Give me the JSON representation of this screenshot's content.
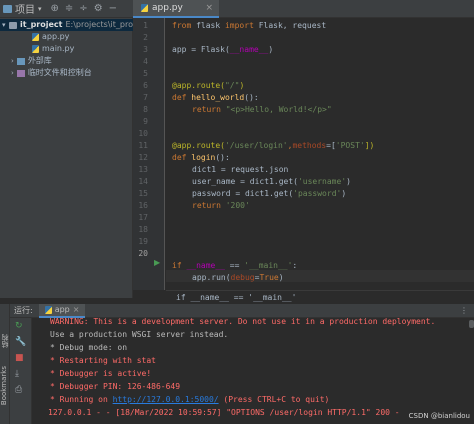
{
  "project": {
    "header_label": "项目",
    "root_name": "it_project",
    "root_path": "E:\\projects\\it_pro",
    "files": [
      "app.py",
      "main.py"
    ],
    "external": "外部库",
    "scratches": "临时文件和控制台"
  },
  "editor": {
    "tab_label": "app.py",
    "line_numbers": [
      "1",
      "2",
      "3",
      "4",
      "5",
      "6",
      "7",
      "8",
      "9",
      "10",
      "11",
      "12",
      "13",
      "14",
      "15",
      "16",
      "17",
      "18",
      "19",
      "20"
    ],
    "breadcrumb": "if __name__ == '__main__'"
  },
  "code": {
    "l1_from": "from",
    "l1_mod": " flask ",
    "l1_import": "import",
    "l1_rest": " Flask, request",
    "l3_a": "app = Flask(",
    "l3_dunder": "__name__",
    "l3_b": ")",
    "l6_dec": "@app.route(",
    "l6_str": "\"/\"",
    "l6_end": ")",
    "l7_def": "def ",
    "l7_fn": "hello_world",
    "l7_rest": "():",
    "l8_ret": "return ",
    "l8_str": "\"<p>Hello, World!</p>\"",
    "l11_dec": "@app.route(",
    "l11_str": "'/user/login'",
    "l11_comma": ",",
    "l11_param": "methods",
    "l11_eq": "=[",
    "l11_post": "'POST'",
    "l11_end": "])",
    "l12_def": "def ",
    "l12_fn": "login",
    "l12_rest": "():",
    "l13": "dict1 = request.json",
    "l14_a": "user_name = dict1.get(",
    "l14_str": "'username'",
    "l14_b": ")",
    "l15_a": "password = dict1.get(",
    "l15_str": "'password'",
    "l15_b": ")",
    "l16_ret": "return ",
    "l16_str": "'200'",
    "l19_if": "if ",
    "l19_dunder": "__name__",
    "l19_mid": " == ",
    "l19_str": "'__main__'",
    "l19_end": ":",
    "l20_a": "app.run(",
    "l20_param": "debug",
    "l20_eq": "=",
    "l20_true": "True",
    "l20_b": ")"
  },
  "run": {
    "label": "运行:",
    "tab": "app",
    "side_labels": [
      "结构",
      "Bookmarks"
    ],
    "lines": {
      "warning": "WARNING: This is a development server. Do not use it in a production deployment.",
      "wsgi": "Use a production WSGI server instead.",
      "debug_mode": "* Debug mode: on",
      "restarting": "* Restarting with stat",
      "debugger_active": "* Debugger is active!",
      "pin": "* Debugger PIN: 126-486-649",
      "running_a": "* Running on ",
      "running_url": "http://127.0.0.1:5000/",
      "running_b": " (Press CTRL+C to quit)",
      "request": "127.0.0.1 - - [18/Mar/2022 10:59:57] \"OPTIONS /user/login HTTP/1.1\" 200 -"
    }
  },
  "watermark": "CSDN @bianlidou"
}
